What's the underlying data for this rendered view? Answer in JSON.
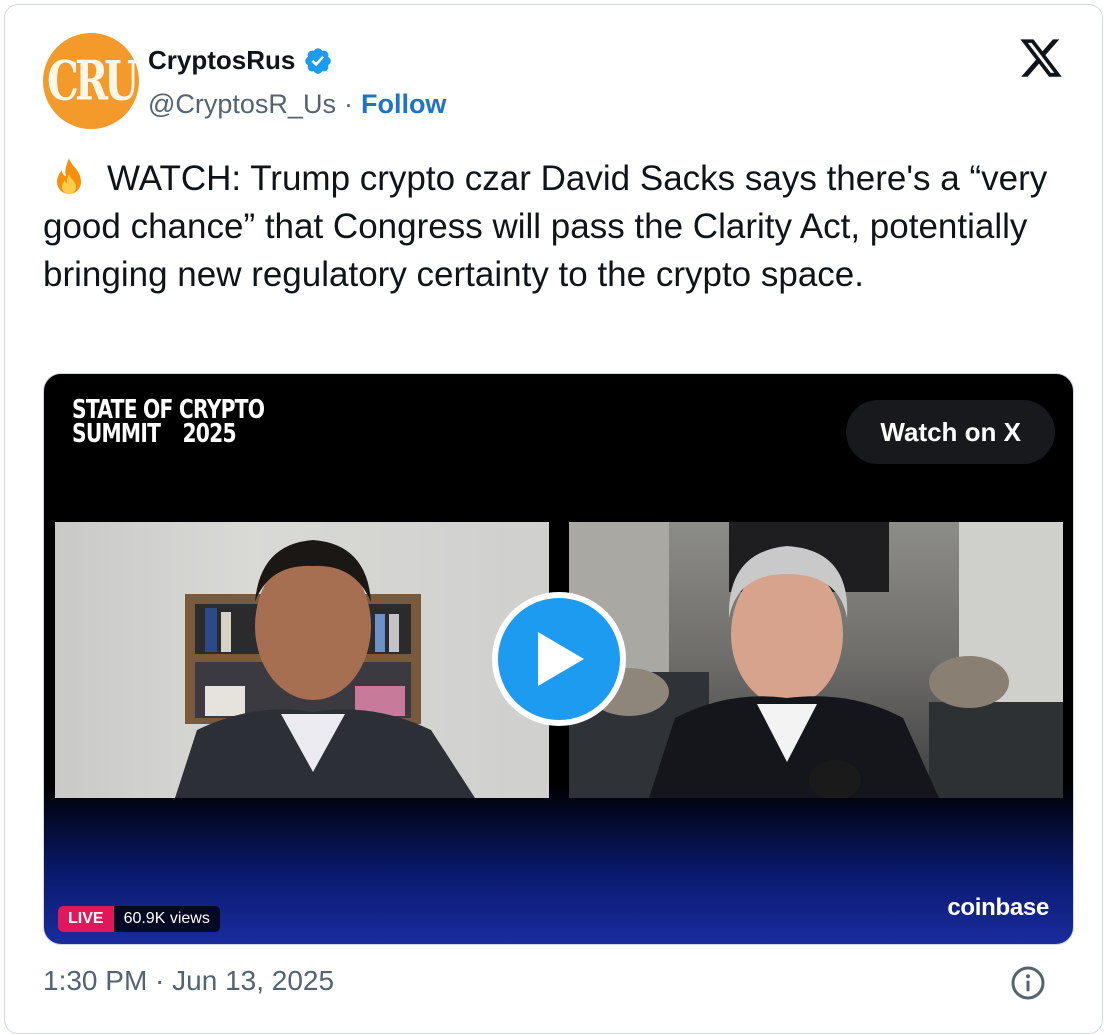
{
  "author": {
    "display_name": "CryptosRus",
    "handle": "@CryptosR_Us",
    "separator": "·",
    "follow_label": "Follow",
    "avatar_text": "CRU",
    "verified": true,
    "avatar_color": "#f39a2b"
  },
  "platform_icon": "x-logo-icon",
  "tweet": {
    "emoji": "fire-icon",
    "text": "WATCH: Trump crypto czar David Sacks says there's a “very good chance” that Congress will pass the Clarity Act, potentially bringing new regulatory certainty to the crypto space."
  },
  "video": {
    "overlay_title_line1": "STATE OF CRYPTO",
    "overlay_title_line2_left": "SUMMIT",
    "overlay_title_line2_right": "2025",
    "watch_button_label": "Watch on X",
    "live_label": "LIVE",
    "views_label": "60.9K views",
    "sponsor": "coinbase",
    "play_button_color": "#1d9bf0",
    "live_color": "#e1175c"
  },
  "footer": {
    "timestamp": "1:30 PM · Jun 13, 2025",
    "info_icon": "info-icon"
  },
  "colors": {
    "follow": "#1d74c9",
    "secondary_text": "#536471",
    "border": "#cfd9de"
  }
}
